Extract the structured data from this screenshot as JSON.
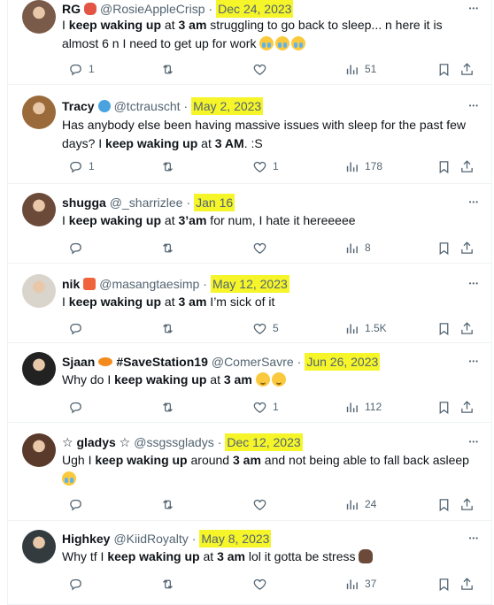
{
  "icons": {
    "more": "more-icon",
    "reply": "reply-icon",
    "retweet": "retweet-icon",
    "like": "heart-icon",
    "views": "views-icon",
    "bookmark": "bookmark-icon",
    "share": "share-icon"
  },
  "highlight_color": "#f5f52a",
  "tweets": [
    {
      "name": "RG",
      "handle": "@RosieAppleCrisp",
      "sep": "·",
      "date": "Dec 24, 2023",
      "text_parts": [
        {
          "t": "I ",
          "b": false
        },
        {
          "t": "keep waking up",
          "b": true
        },
        {
          "t": " at ",
          "b": false
        },
        {
          "t": "3 am",
          "b": true
        },
        {
          "t": " struggling to go back to sleep... n here it is almost 6 n I need to get up for work ",
          "b": false
        }
      ],
      "emoji_count": 3,
      "counts": {
        "reply": "1",
        "retweet": "",
        "like": "",
        "views": "51"
      }
    },
    {
      "name": "Tracy",
      "handle": "@tctrauscht",
      "sep": "·",
      "date": "May 2, 2023",
      "text_parts": [
        {
          "t": "Has anybody else been having massive issues with sleep for the past few days? I ",
          "b": false
        },
        {
          "t": "keep waking up",
          "b": true
        },
        {
          "t": " at ",
          "b": false
        },
        {
          "t": "3 AM",
          "b": true
        },
        {
          "t": ". :S",
          "b": false
        }
      ],
      "counts": {
        "reply": "1",
        "retweet": "",
        "like": "1",
        "views": "178"
      }
    },
    {
      "name": "shugga",
      "handle": "@_sharrizlee",
      "sep": "·",
      "date": "Jan 16",
      "text_parts": [
        {
          "t": "I ",
          "b": false
        },
        {
          "t": "keep waking up",
          "b": true
        },
        {
          "t": " at ",
          "b": false
        },
        {
          "t": "3’am",
          "b": true
        },
        {
          "t": " for num, I hate it hereeeee",
          "b": false
        }
      ],
      "counts": {
        "reply": "",
        "retweet": "",
        "like": "",
        "views": "8"
      }
    },
    {
      "name": "nik",
      "handle": "@masangtaesimp",
      "sep": "·",
      "date": "May 12, 2023",
      "text_parts": [
        {
          "t": "I ",
          "b": false
        },
        {
          "t": "keep waking up",
          "b": true
        },
        {
          "t": " at ",
          "b": false
        },
        {
          "t": "3 am",
          "b": true
        },
        {
          "t": " I’m sick of it",
          "b": false
        }
      ],
      "counts": {
        "reply": "",
        "retweet": "",
        "like": "5",
        "views": "1.5K"
      }
    },
    {
      "name": "Sjaan",
      "name_extra": "#SaveStation19",
      "handle": "@ComerSavre",
      "sep": "·",
      "date": "Jun 26, 2023",
      "text_parts": [
        {
          "t": "Why do I ",
          "b": false
        },
        {
          "t": "keep waking up",
          "b": true
        },
        {
          "t": " at ",
          "b": false
        },
        {
          "t": "3 am",
          "b": true
        },
        {
          "t": " ",
          "b": false
        }
      ],
      "emoji_count": 2,
      "counts": {
        "reply": "",
        "retweet": "",
        "like": "1",
        "views": "112"
      }
    },
    {
      "name": "☆ gladys ☆",
      "handle": "@ssgssgladys",
      "sep": "·",
      "date": "Dec 12, 2023",
      "text_parts": [
        {
          "t": "Ugh I ",
          "b": false
        },
        {
          "t": "keep waking up",
          "b": true
        },
        {
          "t": " around ",
          "b": false
        },
        {
          "t": "3 am",
          "b": true
        },
        {
          "t": " and not being able to fall back asleep",
          "b": false
        }
      ],
      "emoji_count": 1,
      "counts": {
        "reply": "",
        "retweet": "",
        "like": "",
        "views": "24"
      }
    },
    {
      "name": "Highkey",
      "handle": "@KiidRoyalty",
      "sep": "·",
      "date": "May 8, 2023",
      "text_parts": [
        {
          "t": "Why tf I ",
          "b": false
        },
        {
          "t": "keep waking up",
          "b": true
        },
        {
          "t": " at ",
          "b": false
        },
        {
          "t": "3 am",
          "b": true
        },
        {
          "t": " lol it gotta be stress ",
          "b": false
        }
      ],
      "emoji_count": 1,
      "counts": {
        "reply": "",
        "retweet": "",
        "like": "",
        "views": "37"
      }
    }
  ]
}
